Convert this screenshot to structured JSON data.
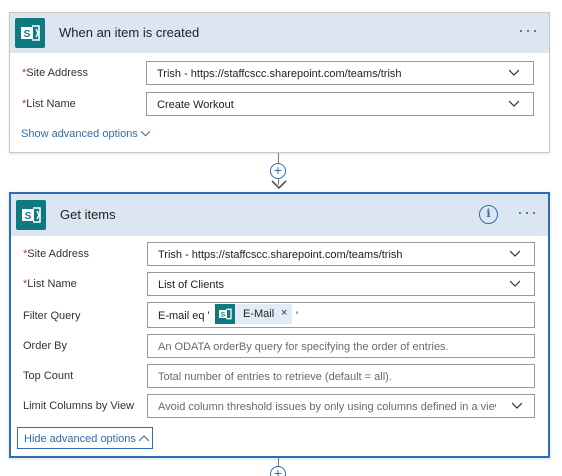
{
  "trigger": {
    "title": "When an item is created",
    "more_label": "···",
    "fields": [
      {
        "label": "Site Address",
        "required_mark": "*",
        "value": "Trish - https://staffcscc.sharepoint.com/teams/trish"
      },
      {
        "label": "List Name",
        "required_mark": "*",
        "value": "Create Workout"
      }
    ],
    "advanced_link": "Show advanced options"
  },
  "connector": {
    "plus_label": "+"
  },
  "action": {
    "title": "Get items",
    "info_label": "i",
    "more_label": "···",
    "site_address": {
      "label": "Site Address",
      "required_mark": "*",
      "value": "Trish - https://staffcscc.sharepoint.com/teams/trish"
    },
    "list_name": {
      "label": "List Name",
      "required_mark": "*",
      "value": "List of Clients"
    },
    "filter_query": {
      "label": "Filter Query",
      "prefix": "E-mail eq '",
      "token": "E-Mail",
      "token_remove": "×",
      "suffix": "'"
    },
    "order_by": {
      "label": "Order By",
      "placeholder": "An ODATA orderBy query for specifying the order of entries."
    },
    "top_count": {
      "label": "Top Count",
      "placeholder": "Total number of entries to retrieve (default = all)."
    },
    "limit_columns": {
      "label": "Limit Columns by View",
      "placeholder": "Avoid column threshold issues by only using columns defined in a view"
    },
    "advanced_button": "Hide advanced options"
  },
  "colors": {
    "accent": "#2f6cb1",
    "sharepoint_icon": "#0e7a80",
    "header_bg": "#dbe6f2",
    "required": "#c0392b"
  }
}
